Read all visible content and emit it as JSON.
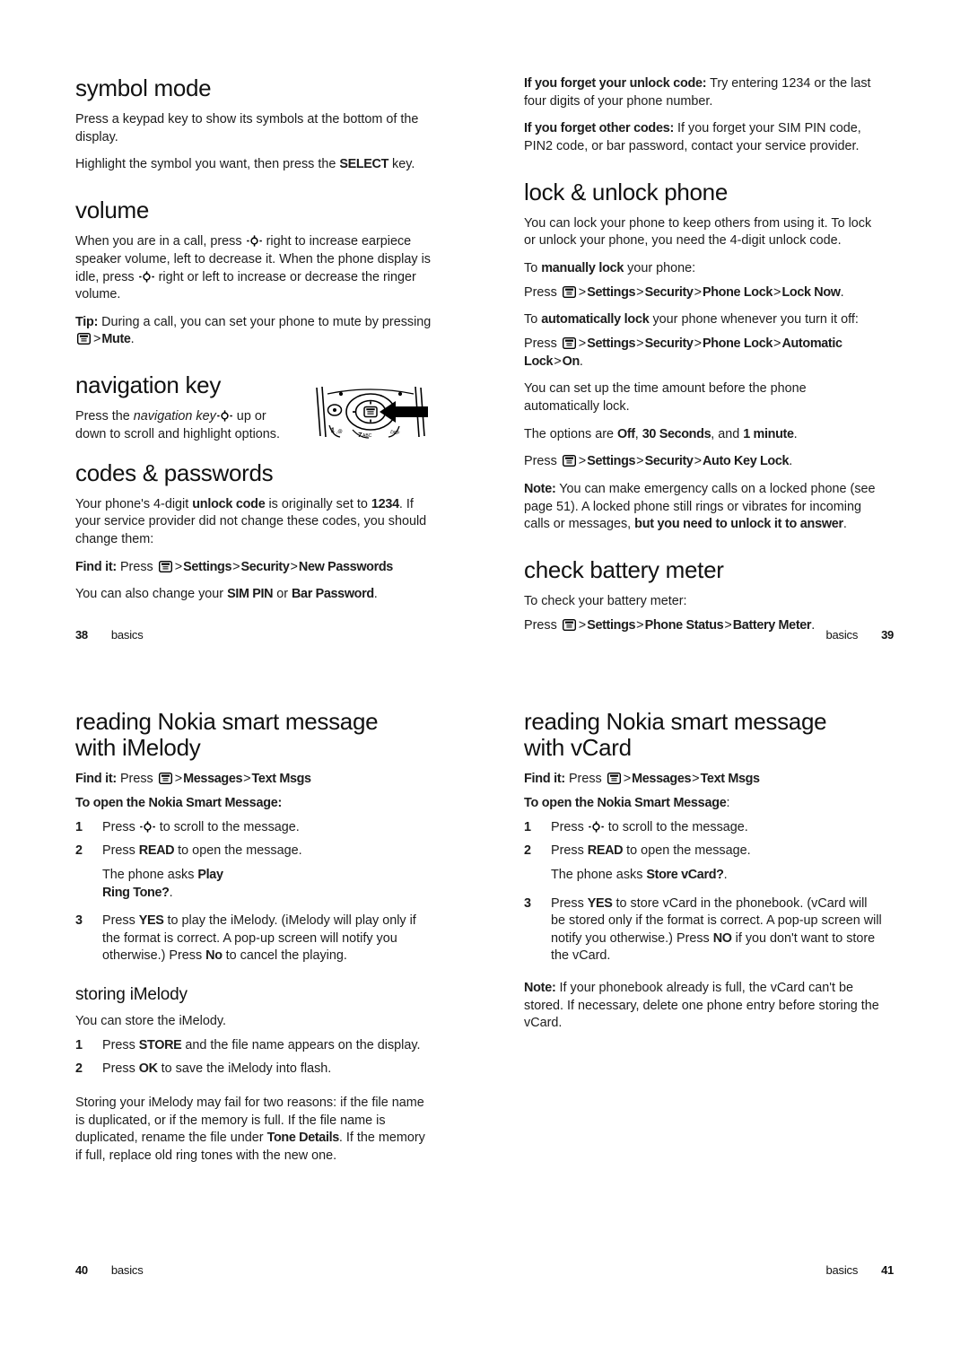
{
  "document": {
    "type": "phone-user-guide-spread",
    "section_name": "basics"
  },
  "pages": [
    {
      "page_number": "38",
      "section": "basics",
      "side": "left",
      "content": {
        "symbol_mode": {
          "heading": "symbol mode",
          "p1": "Press a keypad key to show its symbols at the bottom of the display.",
          "p2_pre": "Highlight the symbol you want, then press the ",
          "p2_cmd": "SELECT",
          "p2_post": " key."
        },
        "volume": {
          "heading": "volume",
          "p1_a": "When you are in a call, press ",
          "p1_b": " right to increase earpiece speaker volume, left to decrease it. When the phone display is idle, press ",
          "p1_c": " right or left to increase or decrease the ringer volume.",
          "tip_label": "Tip:",
          "tip_a": " During a call, you can set your phone to mute by pressing ",
          "tip_gt": ">",
          "tip_cmd": "Mute",
          "tip_end": "."
        },
        "navigation_key": {
          "heading": "navigation key",
          "p1_a": "Press the ",
          "p1_em": "navigation key",
          "p1_b": " up or down to scroll and highlight options.",
          "figure_alt": "phone-keypad-navigation-key-illustration"
        },
        "codes_passwords": {
          "heading": "codes & passwords",
          "p1_a": "Your phone's 4-digit ",
          "p1_b1": "unlock code",
          "p1_c": " is originally set to ",
          "p1_b2": "1234",
          "p1_d": ". If your service provider did not change these codes, you should change them:",
          "findit_label": "Find it:",
          "findit_press": " Press ",
          "findit_path": [
            "Settings",
            "Security",
            "New Passwords"
          ],
          "p2_a": "You can also change your ",
          "p2_b1": "SIM PIN",
          "p2_c": " or ",
          "p2_b2": "Bar Password",
          "p2_d": "."
        }
      }
    },
    {
      "page_number": "39",
      "section": "basics",
      "side": "right",
      "content": {
        "forget_unlock": {
          "label": "If you forget your unlock code:",
          "text": " Try entering 1234 or the last four digits of your phone number."
        },
        "forget_other": {
          "label": "If you forget other codes:",
          "text": " If you forget your SIM PIN code, PIN2 code, or bar password, contact your service provider."
        },
        "lock_unlock": {
          "heading": "lock & unlock phone",
          "p1": "You can lock your phone to keep others from using it. To lock or unlock your phone, you need the 4-digit unlock code.",
          "manual_a": "To ",
          "manual_b": "manually lock",
          "manual_c": " your phone:",
          "manual_press": "Press ",
          "manual_path": [
            "Settings",
            "Security",
            "Phone Lock",
            "Lock Now"
          ],
          "auto_a": "To ",
          "auto_b": "automatically lock",
          "auto_c": " your phone whenever you turn it off:",
          "auto_press": "Press ",
          "auto_path": [
            "Settings",
            "Security",
            "Phone Lock",
            "Automatic Lock",
            "On"
          ],
          "p2": "You can set up the time amount before the phone automatically lock.",
          "options_a": "The options are ",
          "options_1": "Off",
          "options_sep1": ", ",
          "options_2": "30 Seconds",
          "options_sep2": ", and ",
          "options_3": "1 minute",
          "options_end": ".",
          "keylock_press": "Press ",
          "keylock_path": [
            "Settings",
            "Security",
            "Auto Key Lock"
          ],
          "note_label": "Note:",
          "note_a": " You can make emergency calls on a locked phone (see page 51). A locked phone still rings or vibrates for incoming calls or messages, ",
          "note_b": "but you need to unlock it to answer",
          "note_c": "."
        },
        "battery_meter": {
          "heading": "check battery meter",
          "p1": "To check your battery meter:",
          "press": "Press ",
          "path": [
            "Settings",
            "Phone Status",
            "Battery Meter"
          ]
        }
      }
    },
    {
      "page_number": "40",
      "section": "basics",
      "side": "left",
      "content": {
        "imelody": {
          "heading_line1": "reading Nokia smart message",
          "heading_line2": "with iMelody",
          "findit_label": "Find it:",
          "findit_press": " Press ",
          "findit_path": [
            "Messages",
            "Text Msgs"
          ],
          "open_heading": "To open the Nokia Smart Message:",
          "step1_a": "Press ",
          "step1_b": " to scroll to the message.",
          "step2_a": "Press ",
          "step2_cmd": "READ",
          "step2_b": " to open the message.",
          "step2_note_a": "The phone asks ",
          "step2_note_b1": "Play",
          "step2_note_b2": "Ring Tone?",
          "step2_note_end": ".",
          "step3_a": "Press ",
          "step3_cmd1": "YES",
          "step3_b": " to play the iMelody. (iMelody will play only if the format is correct. A pop-up screen will notify you otherwise.) Press ",
          "step3_cmd2": "No",
          "step3_c": " to cancel the playing."
        },
        "storing": {
          "heading": "storing iMelody",
          "p1": "You can store the iMelody.",
          "step1_a": "Press ",
          "step1_cmd": "STORE",
          "step1_b": " and the file name appears on the display.",
          "step2_a": "Press ",
          "step2_cmd": "OK",
          "step2_b": " to save the iMelody into flash.",
          "p2_a": "Storing your iMelody may fail for two reasons: if the file name is duplicated, or if the memory is full. If the file name is duplicated, rename the file under ",
          "p2_cmd": "Tone Details",
          "p2_b": ". If the memory if full, replace old ring tones with the new one."
        }
      }
    },
    {
      "page_number": "41",
      "section": "basics",
      "side": "right",
      "content": {
        "vcard": {
          "heading_line1": "reading Nokia smart message",
          "heading_line2": "with vCard",
          "findit_label": "Find it:",
          "findit_press": " Press ",
          "findit_path": [
            "Messages",
            "Text Msgs"
          ],
          "open_heading": "To open the Nokia Smart Message",
          "open_heading_colon": ":",
          "step1_a": "Press ",
          "step1_b": " to scroll to the message.",
          "step2_a": "Press ",
          "step2_cmd": "READ",
          "step2_b": " to open the message.",
          "step2_note_a": "The phone asks ",
          "step2_note_b": "Store vCard?",
          "step2_note_end": ".",
          "step3_a": "Press ",
          "step3_cmd1": "YES",
          "step3_b": " to store vCard in the phonebook. (vCard will be stored only if the format is correct. A pop-up screen will notify you otherwise.) Press ",
          "step3_cmd2": "NO",
          "step3_c": " if you don't want to store the vCard.",
          "note_label": "Note:",
          "note_text": " If your phonebook already is full, the vCard can't be stored. If necessary, delete one phone entry before storing the vCard."
        }
      }
    }
  ],
  "steps_numbers": {
    "one": "1",
    "two": "2",
    "three": "3"
  },
  "icons": {
    "menu": "menu-key-icon",
    "nav": "navigation-key-icon"
  },
  "colors": {
    "text": "#1c1c1c",
    "heading": "#111111",
    "page_background": "#ffffff",
    "illustration_line": "#000000"
  }
}
